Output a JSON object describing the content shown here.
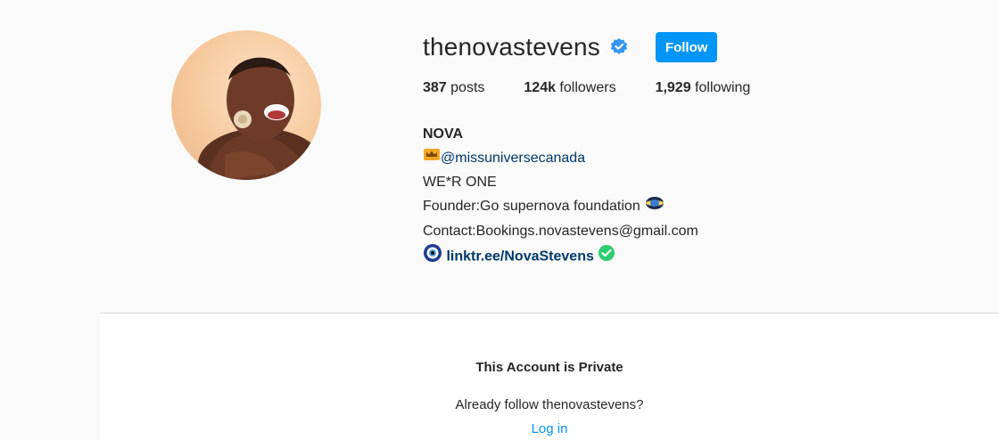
{
  "profile": {
    "username": "thenovastevens",
    "verified": true,
    "follow_label": "Follow",
    "stats": {
      "posts_count": "387",
      "posts_label": " posts",
      "followers_count": "124k",
      "followers_label": " followers",
      "following_count": "1,929",
      "following_label": " following"
    },
    "bio": {
      "name": "NOVA",
      "mention": "@missuniversecanada",
      "line1": "WE*R ONE",
      "line2": "Founder:Go supernova foundation",
      "line3": "Contact:Bookings.novastevens@gmail.com",
      "link": "linktr.ee/NovaStevens"
    }
  },
  "private_notice": {
    "title": "This Account is Private",
    "subtitle": "Already follow thenovastevens?",
    "login_label": "Log in"
  },
  "colors": {
    "accent": "#0095f6",
    "link": "#00376b",
    "verified_badge": "#3897f0",
    "check_green": "#2ecc71"
  },
  "icons": [
    "verified-badge-icon",
    "crown-icon",
    "globe-emoji-icon",
    "evil-eye-icon",
    "check-icon"
  ]
}
